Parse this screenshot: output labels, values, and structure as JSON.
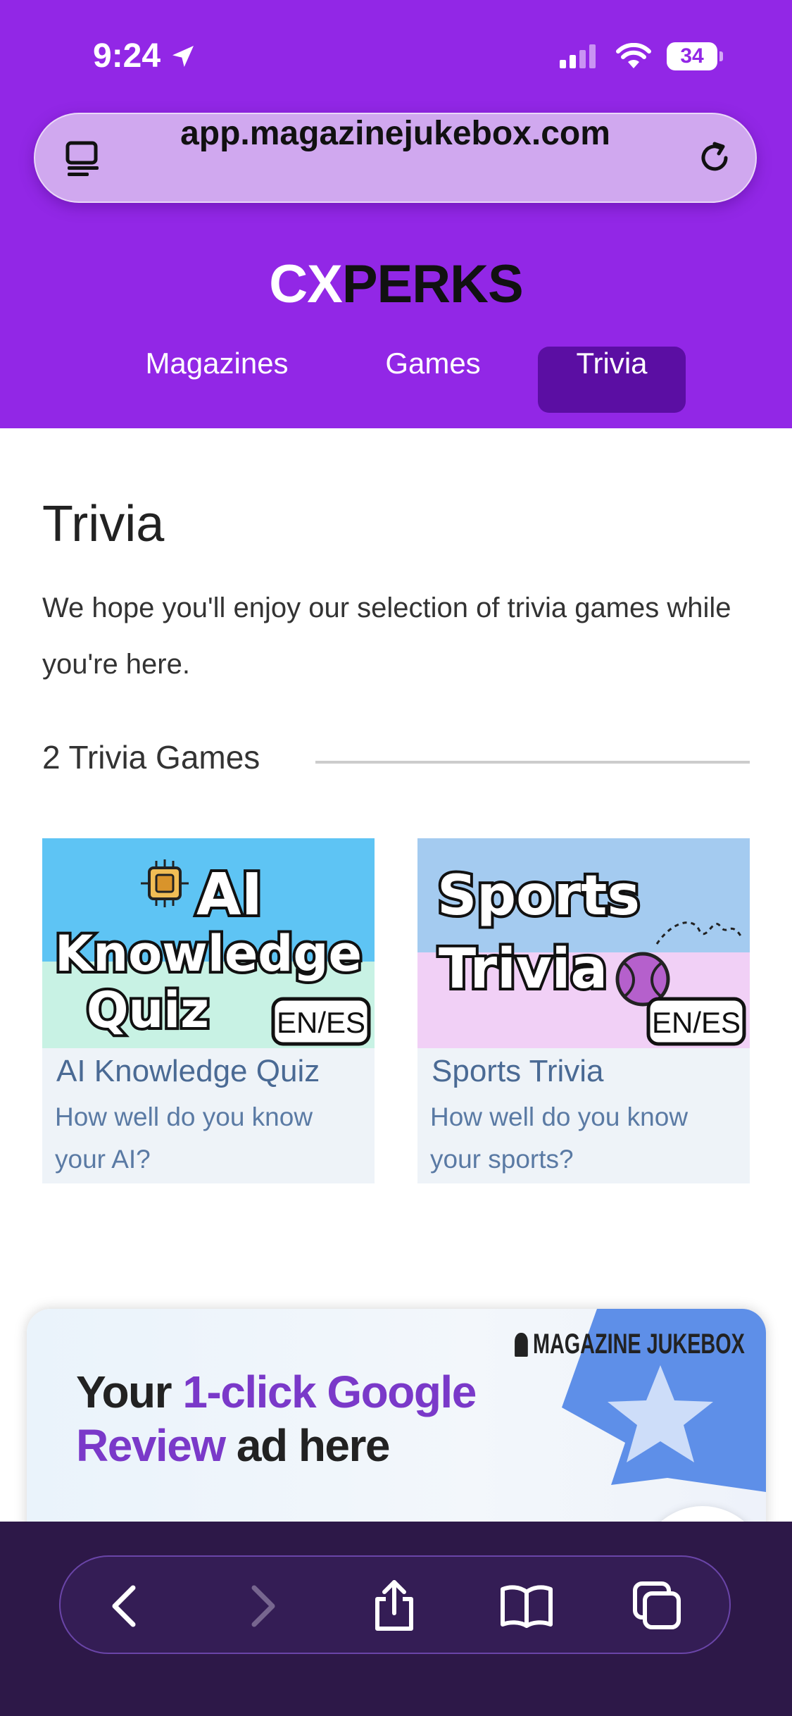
{
  "status": {
    "time": "9:24",
    "battery": "34"
  },
  "browser": {
    "url": "app.magazinejukebox.com"
  },
  "logo": {
    "part1": "CX",
    "part2": "PERKS"
  },
  "nav": {
    "magazines": "Magazines",
    "games": "Games",
    "trivia": "Trivia"
  },
  "page": {
    "title": "Trivia",
    "intro": "We hope you'll enjoy our selection of trivia games while you're here.",
    "count_label": "2 Trivia Games"
  },
  "cards": [
    {
      "image_line1": "AI",
      "image_line2": "Knowledge",
      "image_line3": "Quiz",
      "badge": "EN/ES",
      "title": "AI Knowledge Quiz",
      "description": "How well do you know your AI?"
    },
    {
      "image_line1": "Sports",
      "image_line2": "Trivia",
      "badge": "EN/ES",
      "title": "Sports Trivia",
      "description": "How well do you know your sports?"
    }
  ],
  "ad": {
    "line1a": "Your ",
    "line1b": "1-click Google",
    "line2a": "Review",
    "line2b": " ad here",
    "brand": "MAGAZINE JUKEBOX"
  },
  "colors": {
    "header": "#9227e6",
    "nav_active": "#5b0ea3",
    "bottom_bar": "#2d1848",
    "card_title": "#4a6a94"
  }
}
